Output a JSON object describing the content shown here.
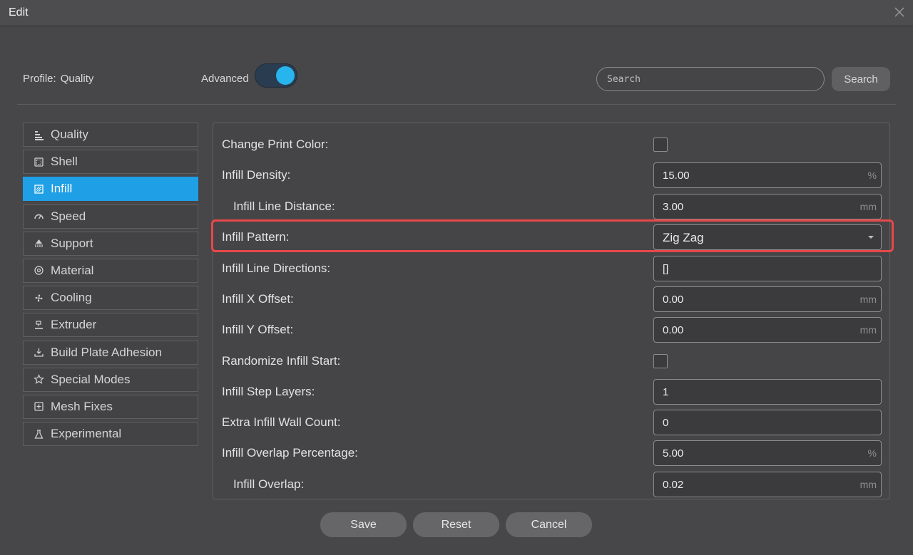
{
  "window": {
    "title": "Edit",
    "close_icon": "close-icon"
  },
  "header": {
    "profile_label": "Profile:",
    "profile_value": "Quality",
    "advanced_label": "Advanced",
    "advanced_enabled": true,
    "search_placeholder": "Search",
    "search_button": "Search"
  },
  "sidebar": {
    "items": [
      {
        "label": "Quality",
        "icon": "quality-icon",
        "active": false
      },
      {
        "label": "Shell",
        "icon": "shell-icon",
        "active": false
      },
      {
        "label": "Infill",
        "icon": "infill-icon",
        "active": true
      },
      {
        "label": "Speed",
        "icon": "speed-icon",
        "active": false
      },
      {
        "label": "Support",
        "icon": "support-icon",
        "active": false
      },
      {
        "label": "Material",
        "icon": "material-icon",
        "active": false
      },
      {
        "label": "Cooling",
        "icon": "cooling-fan-icon",
        "active": false
      },
      {
        "label": "Extruder",
        "icon": "extruder-icon",
        "active": false
      },
      {
        "label": "Build Plate Adhesion",
        "icon": "build-plate-icon",
        "active": false
      },
      {
        "label": "Special Modes",
        "icon": "star-icon",
        "active": false
      },
      {
        "label": "Mesh Fixes",
        "icon": "mesh-fixes-icon",
        "active": false
      },
      {
        "label": "Experimental",
        "icon": "flask-icon",
        "active": false
      }
    ]
  },
  "settings": {
    "rows": [
      {
        "label": "Change Print Color:",
        "type": "checkbox",
        "checked": false,
        "indent": false
      },
      {
        "label": "Infill Density:",
        "type": "number",
        "value": "15.00",
        "unit": "%",
        "indent": false
      },
      {
        "label": "Infill Line Distance:",
        "type": "number",
        "value": "3.00",
        "unit": "mm",
        "indent": true
      },
      {
        "label": "Infill Pattern:",
        "type": "select",
        "value": "Zig Zag",
        "indent": false,
        "highlighted": true
      },
      {
        "label": "Infill Line Directions:",
        "type": "text",
        "value": "[]",
        "indent": false
      },
      {
        "label": "Infill X Offset:",
        "type": "number",
        "value": "0.00",
        "unit": "mm",
        "indent": false
      },
      {
        "label": "Infill Y Offset:",
        "type": "number",
        "value": "0.00",
        "unit": "mm",
        "indent": false
      },
      {
        "label": "Randomize Infill Start:",
        "type": "checkbox",
        "checked": false,
        "indent": false
      },
      {
        "label": "Infill Step Layers:",
        "type": "text",
        "value": "1",
        "indent": false
      },
      {
        "label": "Extra Infill Wall Count:",
        "type": "text",
        "value": "0",
        "indent": false
      },
      {
        "label": "Infill Overlap Percentage:",
        "type": "number",
        "value": "5.00",
        "unit": "%",
        "indent": false
      },
      {
        "label": "Infill Overlap:",
        "type": "number",
        "value": "0.02",
        "unit": "mm",
        "indent": true
      }
    ]
  },
  "footer": {
    "save": "Save",
    "reset": "Reset",
    "cancel": "Cancel"
  },
  "colors": {
    "accent": "#1f9fe6",
    "toggle_knob": "#28b4ec",
    "highlight": "#e8484a"
  }
}
